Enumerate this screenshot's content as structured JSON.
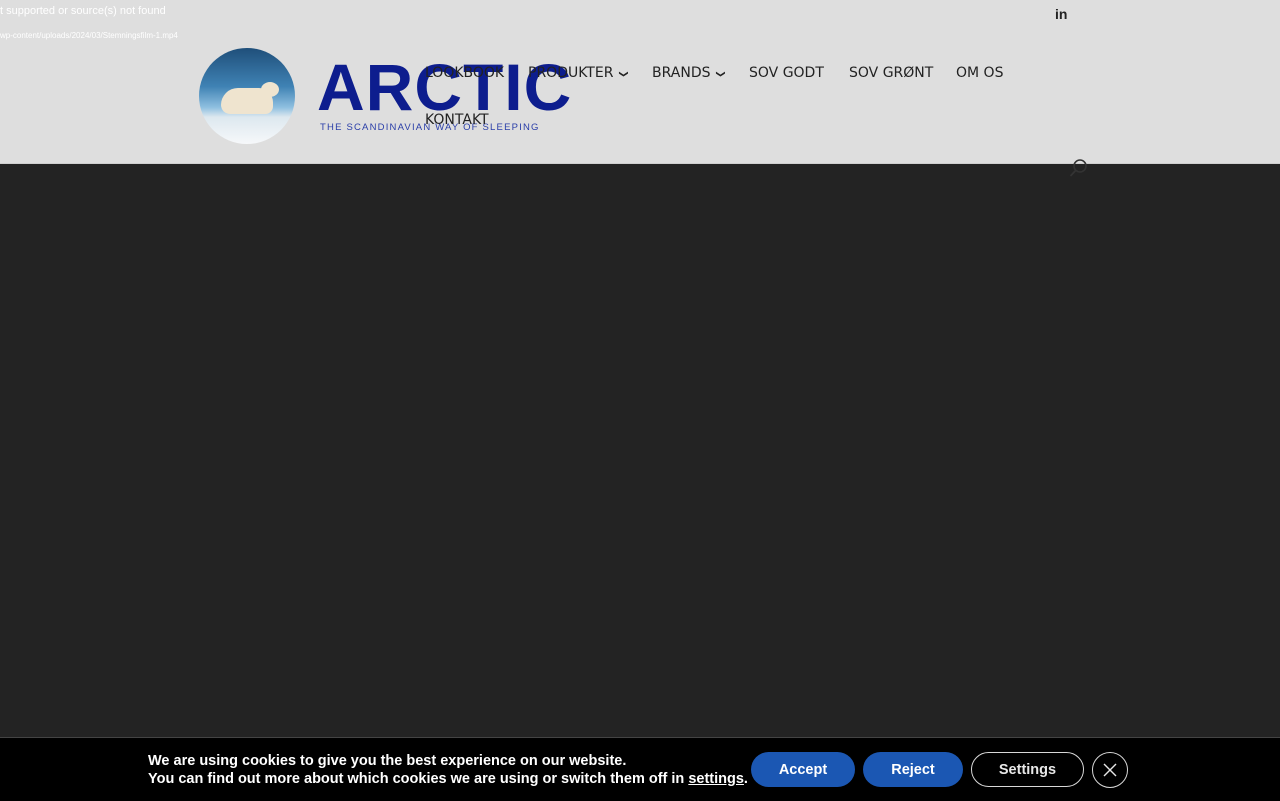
{
  "video_error": {
    "message": "t supported or source(s) not found",
    "source": "wp-content/uploads/2024/03/Stemningsfilm-1.mp4"
  },
  "social": {
    "linkedin_glyph": "in"
  },
  "logo": {
    "word": "ARCTIC",
    "tagline": "THE SCANDINAVIAN WAY OF SLEEPING"
  },
  "nav": {
    "items": [
      {
        "label": "LOOKBOOK",
        "has_dropdown": false
      },
      {
        "label": "PRODUKTER",
        "has_dropdown": true
      },
      {
        "label": "BRANDS",
        "has_dropdown": true
      },
      {
        "label": "SOV GODT",
        "has_dropdown": false
      },
      {
        "label": "SOV GRØNT",
        "has_dropdown": false
      },
      {
        "label": "OM OS",
        "has_dropdown": false
      },
      {
        "label": "KONTAKT",
        "has_dropdown": false
      }
    ],
    "dropdown_glyph": "❯"
  },
  "cookie": {
    "line1": "We are using cookies to give you the best experience on our website.",
    "line2_prefix": "You can find out more about which cookies we are using or switch them off in ",
    "line2_link": "settings",
    "line2_suffix": ".",
    "accept_label": "Accept",
    "reject_label": "Reject",
    "settings_label": "Settings"
  },
  "colors": {
    "header_bg": "#dedede",
    "page_bg": "#232323",
    "brand_blue": "#0d1d8e",
    "button_blue": "#1b57b3"
  },
  "icons": [
    "linkedin-icon",
    "search-icon",
    "close-icon",
    "chevron-down-icon"
  ]
}
